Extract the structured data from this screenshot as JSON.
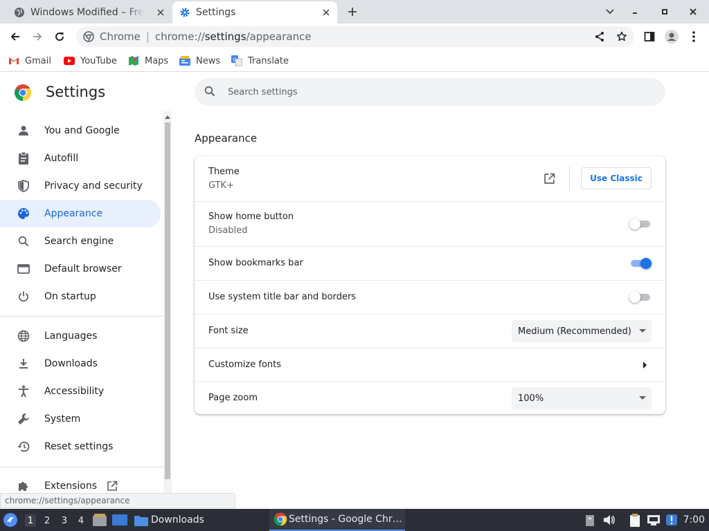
{
  "tabs": [
    {
      "title": "Windows Modified – Free D",
      "icon": "globe-icon"
    },
    {
      "title": "Settings",
      "icon": "settings-gear-icon"
    }
  ],
  "omnibox": {
    "chip": "Chrome",
    "separator": "|",
    "url_prefix": "chrome://",
    "url_host": "settings",
    "url_path": "/appearance"
  },
  "bookmarks": [
    {
      "label": "Gmail",
      "icon": "gmail-icon"
    },
    {
      "label": "YouTube",
      "icon": "youtube-icon"
    },
    {
      "label": "Maps",
      "icon": "maps-icon"
    },
    {
      "label": "News",
      "icon": "news-icon"
    },
    {
      "label": "Translate",
      "icon": "translate-icon"
    }
  ],
  "page": {
    "title": "Settings",
    "search_placeholder": "Search settings"
  },
  "sidebar": {
    "items": [
      {
        "label": "You and Google",
        "icon": "person-icon"
      },
      {
        "label": "Autofill",
        "icon": "clipboard-icon"
      },
      {
        "label": "Privacy and security",
        "icon": "shield-icon"
      },
      {
        "label": "Appearance",
        "icon": "palette-icon",
        "active": true
      },
      {
        "label": "Search engine",
        "icon": "search-icon"
      },
      {
        "label": "Default browser",
        "icon": "browser-window-icon"
      },
      {
        "label": "On startup",
        "icon": "power-icon"
      },
      {
        "label": "Languages",
        "icon": "globe-icon"
      },
      {
        "label": "Downloads",
        "icon": "download-icon"
      },
      {
        "label": "Accessibility",
        "icon": "accessibility-icon"
      },
      {
        "label": "System",
        "icon": "wrench-icon"
      },
      {
        "label": "Reset settings",
        "icon": "history-icon"
      },
      {
        "label": "Extensions",
        "icon": "puzzle-icon"
      }
    ]
  },
  "status_url": "chrome://settings/appearance",
  "appearance": {
    "section_title": "Appearance",
    "theme": {
      "label": "Theme",
      "value": "GTK+",
      "button": "Use Classic"
    },
    "home_button": {
      "label": "Show home button",
      "value": "Disabled",
      "enabled": false
    },
    "bookmarks_bar": {
      "label": "Show bookmarks bar",
      "enabled": true
    },
    "system_title_bar": {
      "label": "Use system title bar and borders",
      "enabled": false
    },
    "font_size": {
      "label": "Font size",
      "value": "Medium (Recommended)"
    },
    "customize_fonts": {
      "label": "Customize fonts"
    },
    "page_zoom": {
      "label": "Page zoom",
      "value": "100%"
    }
  },
  "taskbar": {
    "workspaces": [
      "1",
      "2",
      "3",
      "4"
    ],
    "downloads_label": "Downloads",
    "active_task": "Settings - Google Chr…",
    "clock": "7:00"
  },
  "colors": {
    "accent": "#1a73e8",
    "active_bg": "#e8f0fe",
    "taskbar": "#2b2e37"
  }
}
